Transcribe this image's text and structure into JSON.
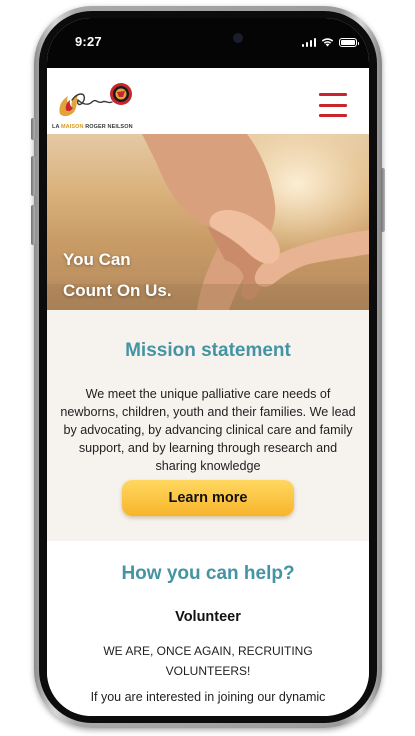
{
  "status_bar": {
    "time": "9:27",
    "battery_level": 1.0
  },
  "header": {
    "logo": {
      "script_text": "Roger",
      "prefix": "LA ",
      "accent_word": "MAISON",
      "suffix": " ROGER NEILSON"
    },
    "menu_icon": "hamburger-menu-icon"
  },
  "hero": {
    "line1": "You Can",
    "line2": "Count On Us."
  },
  "mission": {
    "title": "Mission statement",
    "text": "We meet the unique palliative care needs of newborns, children, youth and their families. We lead by advocating, by advancing clinical care and family support, and by learning through research and sharing knowledge",
    "button_label": "Learn more"
  },
  "help": {
    "title": "How you can help?",
    "subtitle": "Volunteer",
    "recruit_text": "WE ARE, ONCE AGAIN, RECRUITING VOLUNTEERS!",
    "more_text": "If you are interested in joining our dynamic"
  },
  "colors": {
    "accent_teal": "#4594a3",
    "menu_red": "#c9252c",
    "button_gold": "#f8b52b",
    "section_bg": "#f6f3ef"
  }
}
